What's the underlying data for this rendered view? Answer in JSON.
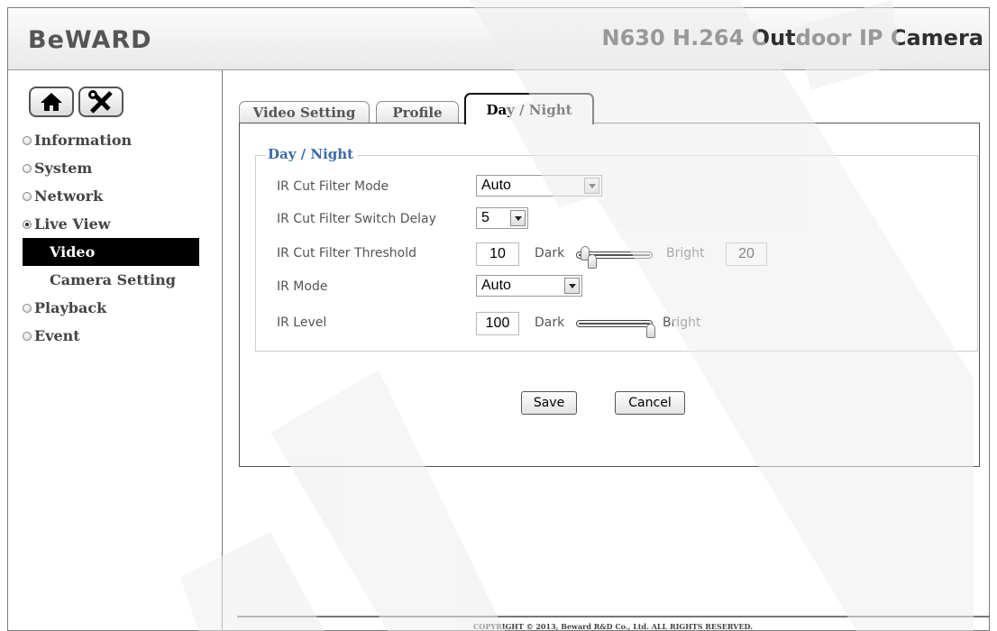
{
  "header": {
    "logo_text": "BeWARD",
    "model_title": "N630 H.264 Outdoor IP Camera"
  },
  "toolbar": {
    "home_icon": "home-icon",
    "settings_icon": "tools-icon"
  },
  "sidebar": {
    "items": [
      {
        "label": "Information",
        "selected": false
      },
      {
        "label": "System",
        "selected": false
      },
      {
        "label": "Network",
        "selected": false
      },
      {
        "label": "Live View",
        "selected": true
      },
      {
        "label": "Playback",
        "selected": false
      },
      {
        "label": "Event",
        "selected": false
      }
    ],
    "sub_items": [
      {
        "label": "Video",
        "active": true
      },
      {
        "label": "Camera Setting",
        "active": false
      }
    ]
  },
  "tabs": [
    {
      "label": "Video Setting",
      "active": false
    },
    {
      "label": "Profile",
      "active": false
    },
    {
      "label": "Day / Night",
      "active": true
    }
  ],
  "form": {
    "legend": "Day / Night",
    "ir_cut_mode": {
      "label": "IR Cut Filter Mode",
      "value": "Auto"
    },
    "switch_delay": {
      "label": "IR Cut Filter Switch Delay",
      "value": "5"
    },
    "threshold": {
      "label": "IR Cut Filter Threshold",
      "dark_value": "10",
      "bright_value": "20",
      "dark_word": "Dark",
      "bright_word": "Bright"
    },
    "ir_mode": {
      "label": "IR Mode",
      "value": "Auto"
    },
    "ir_level": {
      "label": "IR Level",
      "value": "100",
      "dark_word": "Dark",
      "bright_word": "Bright"
    }
  },
  "buttons": {
    "save": "Save",
    "cancel": "Cancel"
  },
  "footer": {
    "copyright": "COPYRIGHT © 2013, Beward R&D Co., Ltd. ALL RIGHTS RESERVED."
  },
  "colors": {
    "legend": "#3a6aa8",
    "active_nav_bg": "#000000",
    "watermark": "#eeeeee"
  }
}
